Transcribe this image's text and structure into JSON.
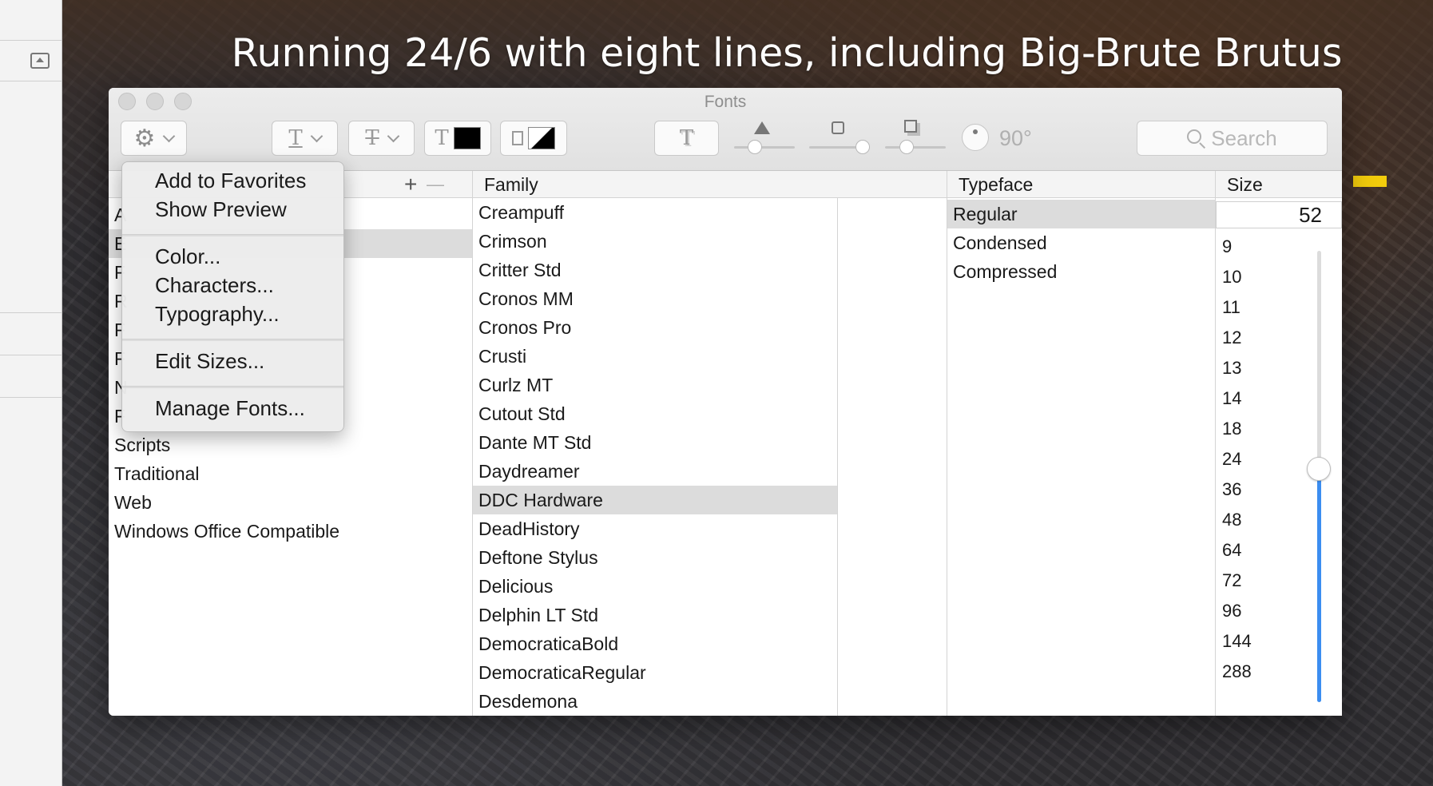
{
  "headline": "Running 24/6 with eight lines, including Big-Brute Brutus",
  "window": {
    "title": "Fonts"
  },
  "toolbar": {
    "rotation_value": "90°",
    "search_placeholder": "Search",
    "text_color": "#000000"
  },
  "collections": {
    "header": "",
    "add_label": "+",
    "remove_label": "—",
    "items": [
      "A",
      "E",
      "F",
      "R",
      "F",
      "F",
      "N",
      "F",
      "Scripts",
      "Traditional",
      "Web",
      "Windows Office Compatible"
    ]
  },
  "family": {
    "header": "Family",
    "items": [
      "Creampuff",
      "Crimson",
      "Critter Std",
      "Cronos MM",
      "Cronos Pro",
      "Crusti",
      "Curlz MT",
      "Cutout Std",
      "Dante MT Std",
      "Daydreamer",
      "DDC Hardware",
      "DeadHistory",
      "Deftone Stylus",
      "Delicious",
      "Delphin LT Std",
      "DemocraticaBold",
      "DemocraticaRegular",
      "Desdemona"
    ],
    "selected": "DDC Hardware"
  },
  "typeface": {
    "header": "Typeface",
    "items": [
      "Regular",
      "Condensed",
      "Compressed"
    ],
    "selected": "Regular"
  },
  "size": {
    "header": "Size",
    "value": "52",
    "items": [
      "9",
      "10",
      "11",
      "12",
      "13",
      "14",
      "18",
      "24",
      "36",
      "48",
      "64",
      "72",
      "96",
      "144",
      "288"
    ]
  },
  "menu": {
    "items": {
      "add_to_favorites": "Add to Favorites",
      "show_preview": "Show Preview",
      "color": "Color...",
      "characters": "Characters...",
      "typography": "Typography...",
      "edit_sizes": "Edit Sizes...",
      "manage_fonts": "Manage Fonts..."
    }
  },
  "colors": {
    "accent": "#3b8df0",
    "highlight": "#f2cc0c"
  }
}
